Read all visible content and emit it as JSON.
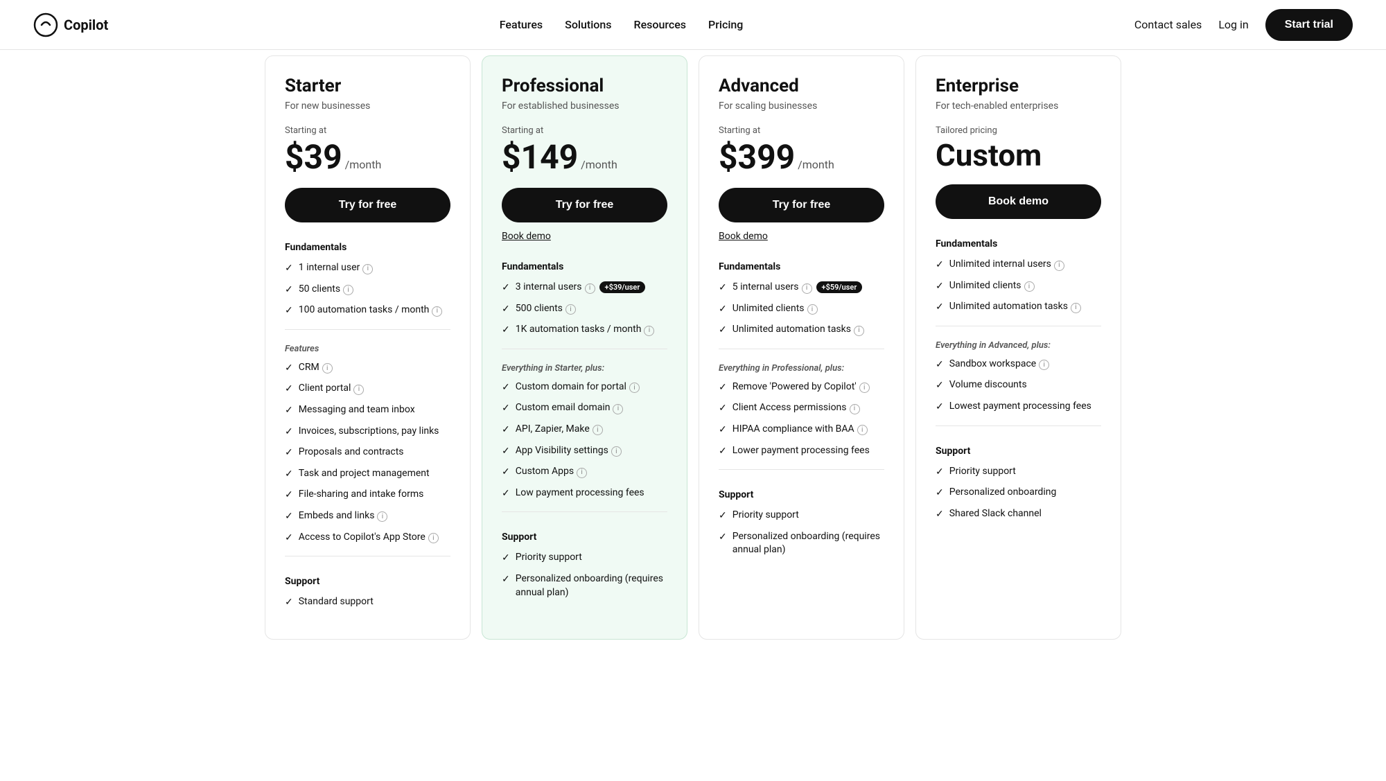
{
  "nav": {
    "logo_text": "Copilot",
    "links": [
      "Features",
      "Solutions",
      "Resources",
      "Pricing"
    ],
    "contact_sales": "Contact sales",
    "log_in": "Log in",
    "start_trial": "Start trial"
  },
  "plans": [
    {
      "id": "starter",
      "name": "Starter",
      "desc": "For new businesses",
      "pricing_label": "Starting at",
      "price": "$39",
      "price_period": "/month",
      "cta_primary": "Try for free",
      "cta_secondary": null,
      "highlighted": false,
      "fundamentals_title": "Fundamentals",
      "fundamentals": [
        {
          "text": "1 internal user",
          "info": true,
          "badge": null
        },
        {
          "text": "50 clients",
          "info": true,
          "badge": null
        },
        {
          "text": "100 automation tasks / month",
          "info": true,
          "badge": null
        }
      ],
      "features_title": "Features",
      "features": [
        {
          "text": "CRM",
          "info": true
        },
        {
          "text": "Client portal",
          "info": true
        },
        {
          "text": "Messaging and team inbox",
          "info": false
        },
        {
          "text": "Invoices, subscriptions, pay links",
          "info": false
        },
        {
          "text": "Proposals and contracts",
          "info": false
        },
        {
          "text": "Task and project management",
          "info": false
        },
        {
          "text": "File-sharing and intake forms",
          "info": false
        },
        {
          "text": "Embeds and links",
          "info": true
        },
        {
          "text": "Access to Copilot's App Store",
          "info": true
        }
      ],
      "support_title": "Support",
      "support": [
        {
          "text": "Standard support",
          "info": false
        }
      ]
    },
    {
      "id": "professional",
      "name": "Professional",
      "desc": "For established businesses",
      "pricing_label": "Starting at",
      "price": "$149",
      "price_period": "/month",
      "cta_primary": "Try for free",
      "cta_secondary": "Book demo",
      "highlighted": true,
      "fundamentals_title": "Fundamentals",
      "fundamentals": [
        {
          "text": "3 internal users",
          "info": true,
          "badge": "+$39/user"
        },
        {
          "text": "500 clients",
          "info": true,
          "badge": null
        },
        {
          "text": "1K automation tasks / month",
          "info": true,
          "badge": null
        }
      ],
      "features_title": "Everything in Starter, plus:",
      "features": [
        {
          "text": "Custom domain for portal",
          "info": true
        },
        {
          "text": "Custom email domain",
          "info": true
        },
        {
          "text": "API, Zapier, Make",
          "info": true
        },
        {
          "text": "App Visibility settings",
          "info": true
        },
        {
          "text": "Custom Apps",
          "info": true
        },
        {
          "text": "Low payment processing fees",
          "info": false
        }
      ],
      "support_title": "Support",
      "support": [
        {
          "text": "Priority support",
          "info": false
        },
        {
          "text": "Personalized onboarding (requires annual plan)",
          "info": false
        }
      ]
    },
    {
      "id": "advanced",
      "name": "Advanced",
      "desc": "For scaling businesses",
      "pricing_label": "Starting at",
      "price": "$399",
      "price_period": "/month",
      "cta_primary": "Try for free",
      "cta_secondary": "Book demo",
      "highlighted": false,
      "fundamentals_title": "Fundamentals",
      "fundamentals": [
        {
          "text": "5 internal users",
          "info": true,
          "badge": "+$59/user"
        },
        {
          "text": "Unlimited clients",
          "info": true,
          "badge": null
        },
        {
          "text": "Unlimited automation tasks",
          "info": true,
          "badge": null
        }
      ],
      "features_title": "Everything in Professional, plus:",
      "features": [
        {
          "text": "Remove 'Powered by Copilot'",
          "info": true
        },
        {
          "text": "Client Access permissions",
          "info": true
        },
        {
          "text": "HIPAA compliance with BAA",
          "info": true
        },
        {
          "text": "Lower payment processing fees",
          "info": false
        }
      ],
      "support_title": "Support",
      "support": [
        {
          "text": "Priority support",
          "info": false
        },
        {
          "text": "Personalized onboarding (requires annual plan)",
          "info": false
        }
      ]
    },
    {
      "id": "enterprise",
      "name": "Enterprise",
      "desc": "For tech-enabled enterprises",
      "pricing_label": "Tailored pricing",
      "price": "Custom",
      "price_period": null,
      "cta_primary": "Book demo",
      "cta_secondary": null,
      "highlighted": false,
      "fundamentals_title": "Fundamentals",
      "fundamentals": [
        {
          "text": "Unlimited internal users",
          "info": true,
          "badge": null
        },
        {
          "text": "Unlimited clients",
          "info": true,
          "badge": null
        },
        {
          "text": "Unlimited automation tasks",
          "info": true,
          "badge": null
        }
      ],
      "features_title": "Everything in Advanced, plus:",
      "features": [
        {
          "text": "Sandbox workspace",
          "info": true
        },
        {
          "text": "Volume discounts",
          "info": false
        },
        {
          "text": "Lowest payment processing fees",
          "info": false
        }
      ],
      "support_title": "Support",
      "support": [
        {
          "text": "Priority support",
          "info": false
        },
        {
          "text": "Personalized onboarding",
          "info": false
        },
        {
          "text": "Shared Slack channel",
          "info": false
        }
      ]
    }
  ]
}
